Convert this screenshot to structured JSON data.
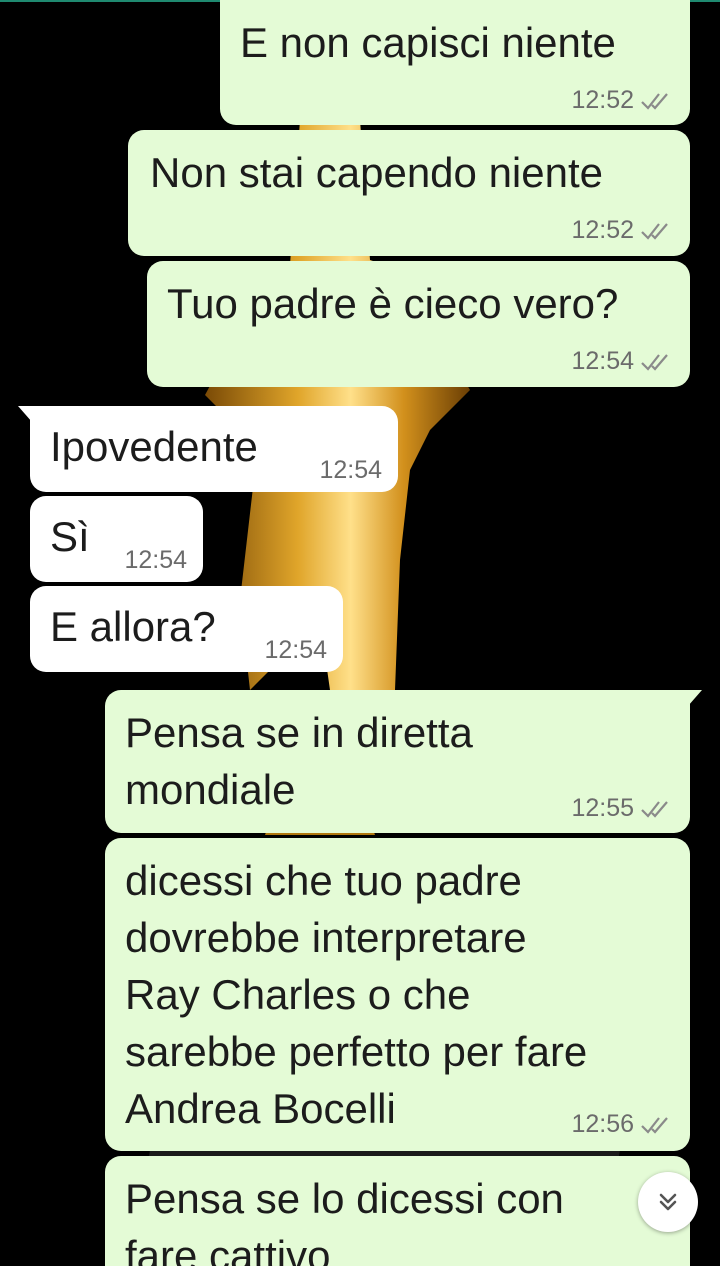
{
  "theme": {
    "outgoing_bubble": "#e4fbd6",
    "incoming_bubble": "#ffffff",
    "tick_color": "#8a8a8a"
  },
  "messages": [
    {
      "direction": "out",
      "text": "E non capisci niente",
      "time": "12:52",
      "status_icon": "double-check-icon"
    },
    {
      "direction": "out",
      "text": "Non stai capendo niente",
      "time": "12:52",
      "status_icon": "double-check-icon"
    },
    {
      "direction": "out",
      "text": "Tuo padre è cieco vero?",
      "time": "12:54",
      "status_icon": "double-check-icon"
    },
    {
      "direction": "in",
      "text": "Ipovedente",
      "time": "12:54"
    },
    {
      "direction": "in",
      "text": "Sì",
      "time": "12:54"
    },
    {
      "direction": "in",
      "text": "E allora?",
      "time": "12:54"
    },
    {
      "direction": "out",
      "text": "Pensa se in diretta\nmondiale",
      "time": "12:55",
      "status_icon": "double-check-icon"
    },
    {
      "direction": "out",
      "text": "dicessi che tuo padre\ndovrebbe interpretare\nRay Charles o che\nsarebbe perfetto per fare\nAndrea Bocelli",
      "time": "12:56",
      "status_icon": "double-check-icon"
    },
    {
      "direction": "out",
      "text": "Pensa se lo dicessi con\nfare cattivo",
      "time": "",
      "status_icon": ""
    }
  ],
  "scroll_button": {
    "icon": "chevron-double-down-icon"
  }
}
